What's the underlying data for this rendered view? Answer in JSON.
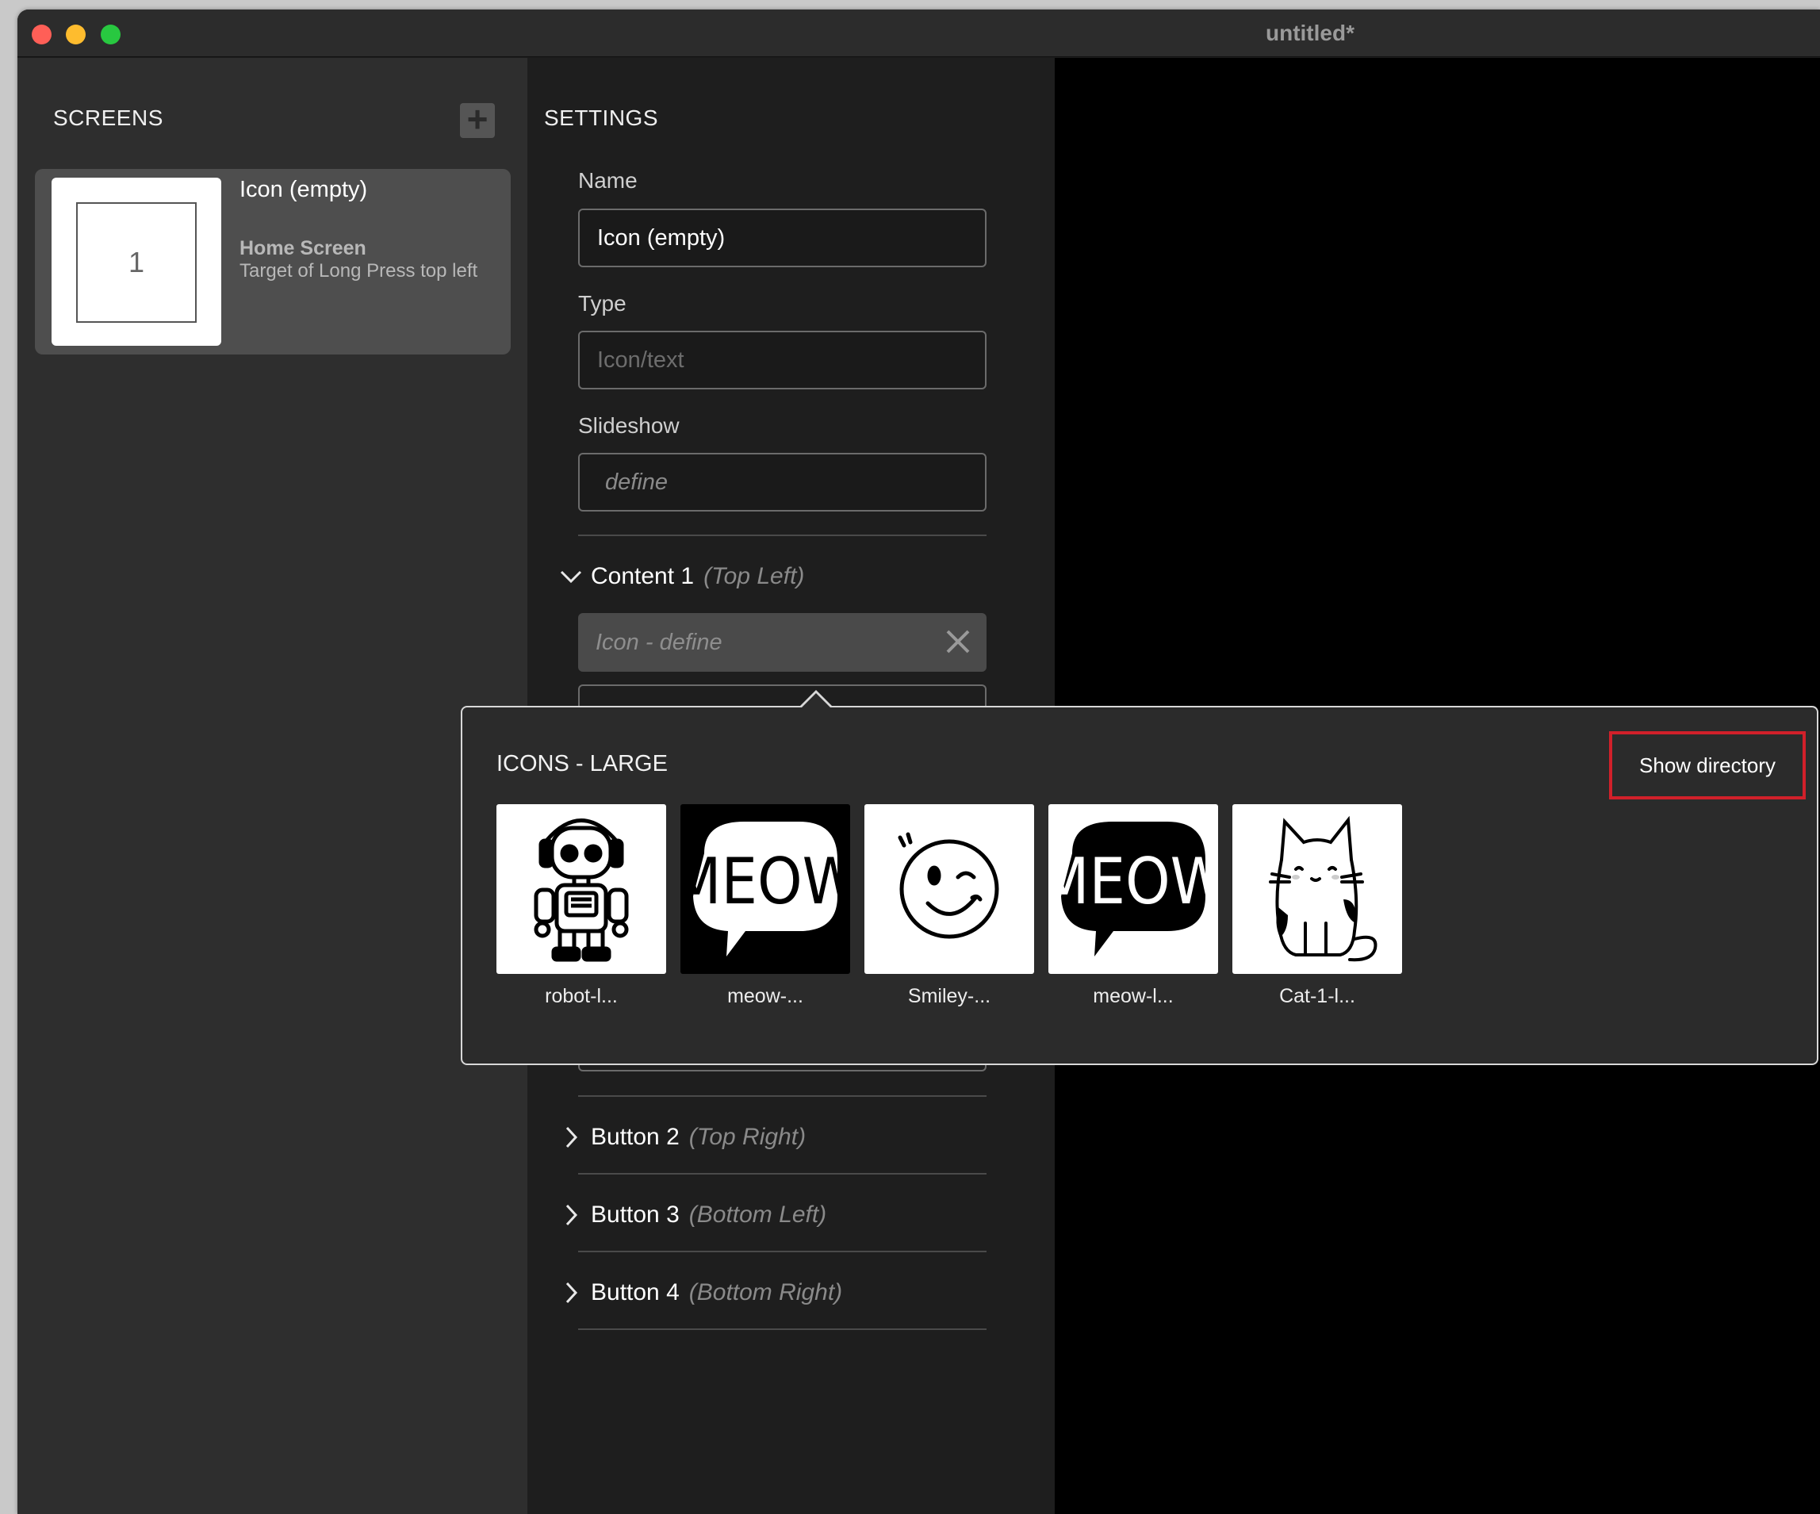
{
  "window": {
    "title": "untitled*"
  },
  "screens": {
    "heading": "SCREENS",
    "add_label": "+",
    "items": [
      {
        "thumb_number": "1",
        "title": "Icon (empty)",
        "subtitle": "Home Screen",
        "description": "Target of Long Press top left"
      }
    ]
  },
  "settings": {
    "heading": "SETTINGS",
    "name_label": "Name",
    "name_value": "Icon (empty)",
    "type_label": "Type",
    "type_placeholder": "Icon/text",
    "slideshow_label": "Slideshow",
    "slideshow_value": "define",
    "content1": {
      "name": "Content 1",
      "position": "(Top Left)",
      "icon_value": "Icon - define"
    },
    "sections": [
      {
        "name": "Button 2",
        "position": "(Top Right)"
      },
      {
        "name": "Button 3",
        "position": "(Bottom Left)"
      },
      {
        "name": "Button 4",
        "position": "(Bottom Right)"
      }
    ]
  },
  "popover": {
    "heading": "ICONS - LARGE",
    "show_directory": "Show directory",
    "icons": [
      {
        "label": "robot-l...",
        "icon": "robot-icon",
        "background": "#ffffff"
      },
      {
        "label": "meow-...",
        "icon": "meow-bubble-icon",
        "background": "#000000"
      },
      {
        "label": "Smiley-...",
        "icon": "smiley-icon",
        "background": "#ffffff"
      },
      {
        "label": "meow-l...",
        "icon": "meow-bubble-icon",
        "background": "#ffffff"
      },
      {
        "label": "Cat-1-l...",
        "icon": "cat-icon",
        "background": "#ffffff"
      }
    ]
  },
  "colors": {
    "highlight_border": "#d1202a",
    "close": "#ff5f57",
    "minimize": "#febc2e",
    "maximize": "#28c840"
  }
}
